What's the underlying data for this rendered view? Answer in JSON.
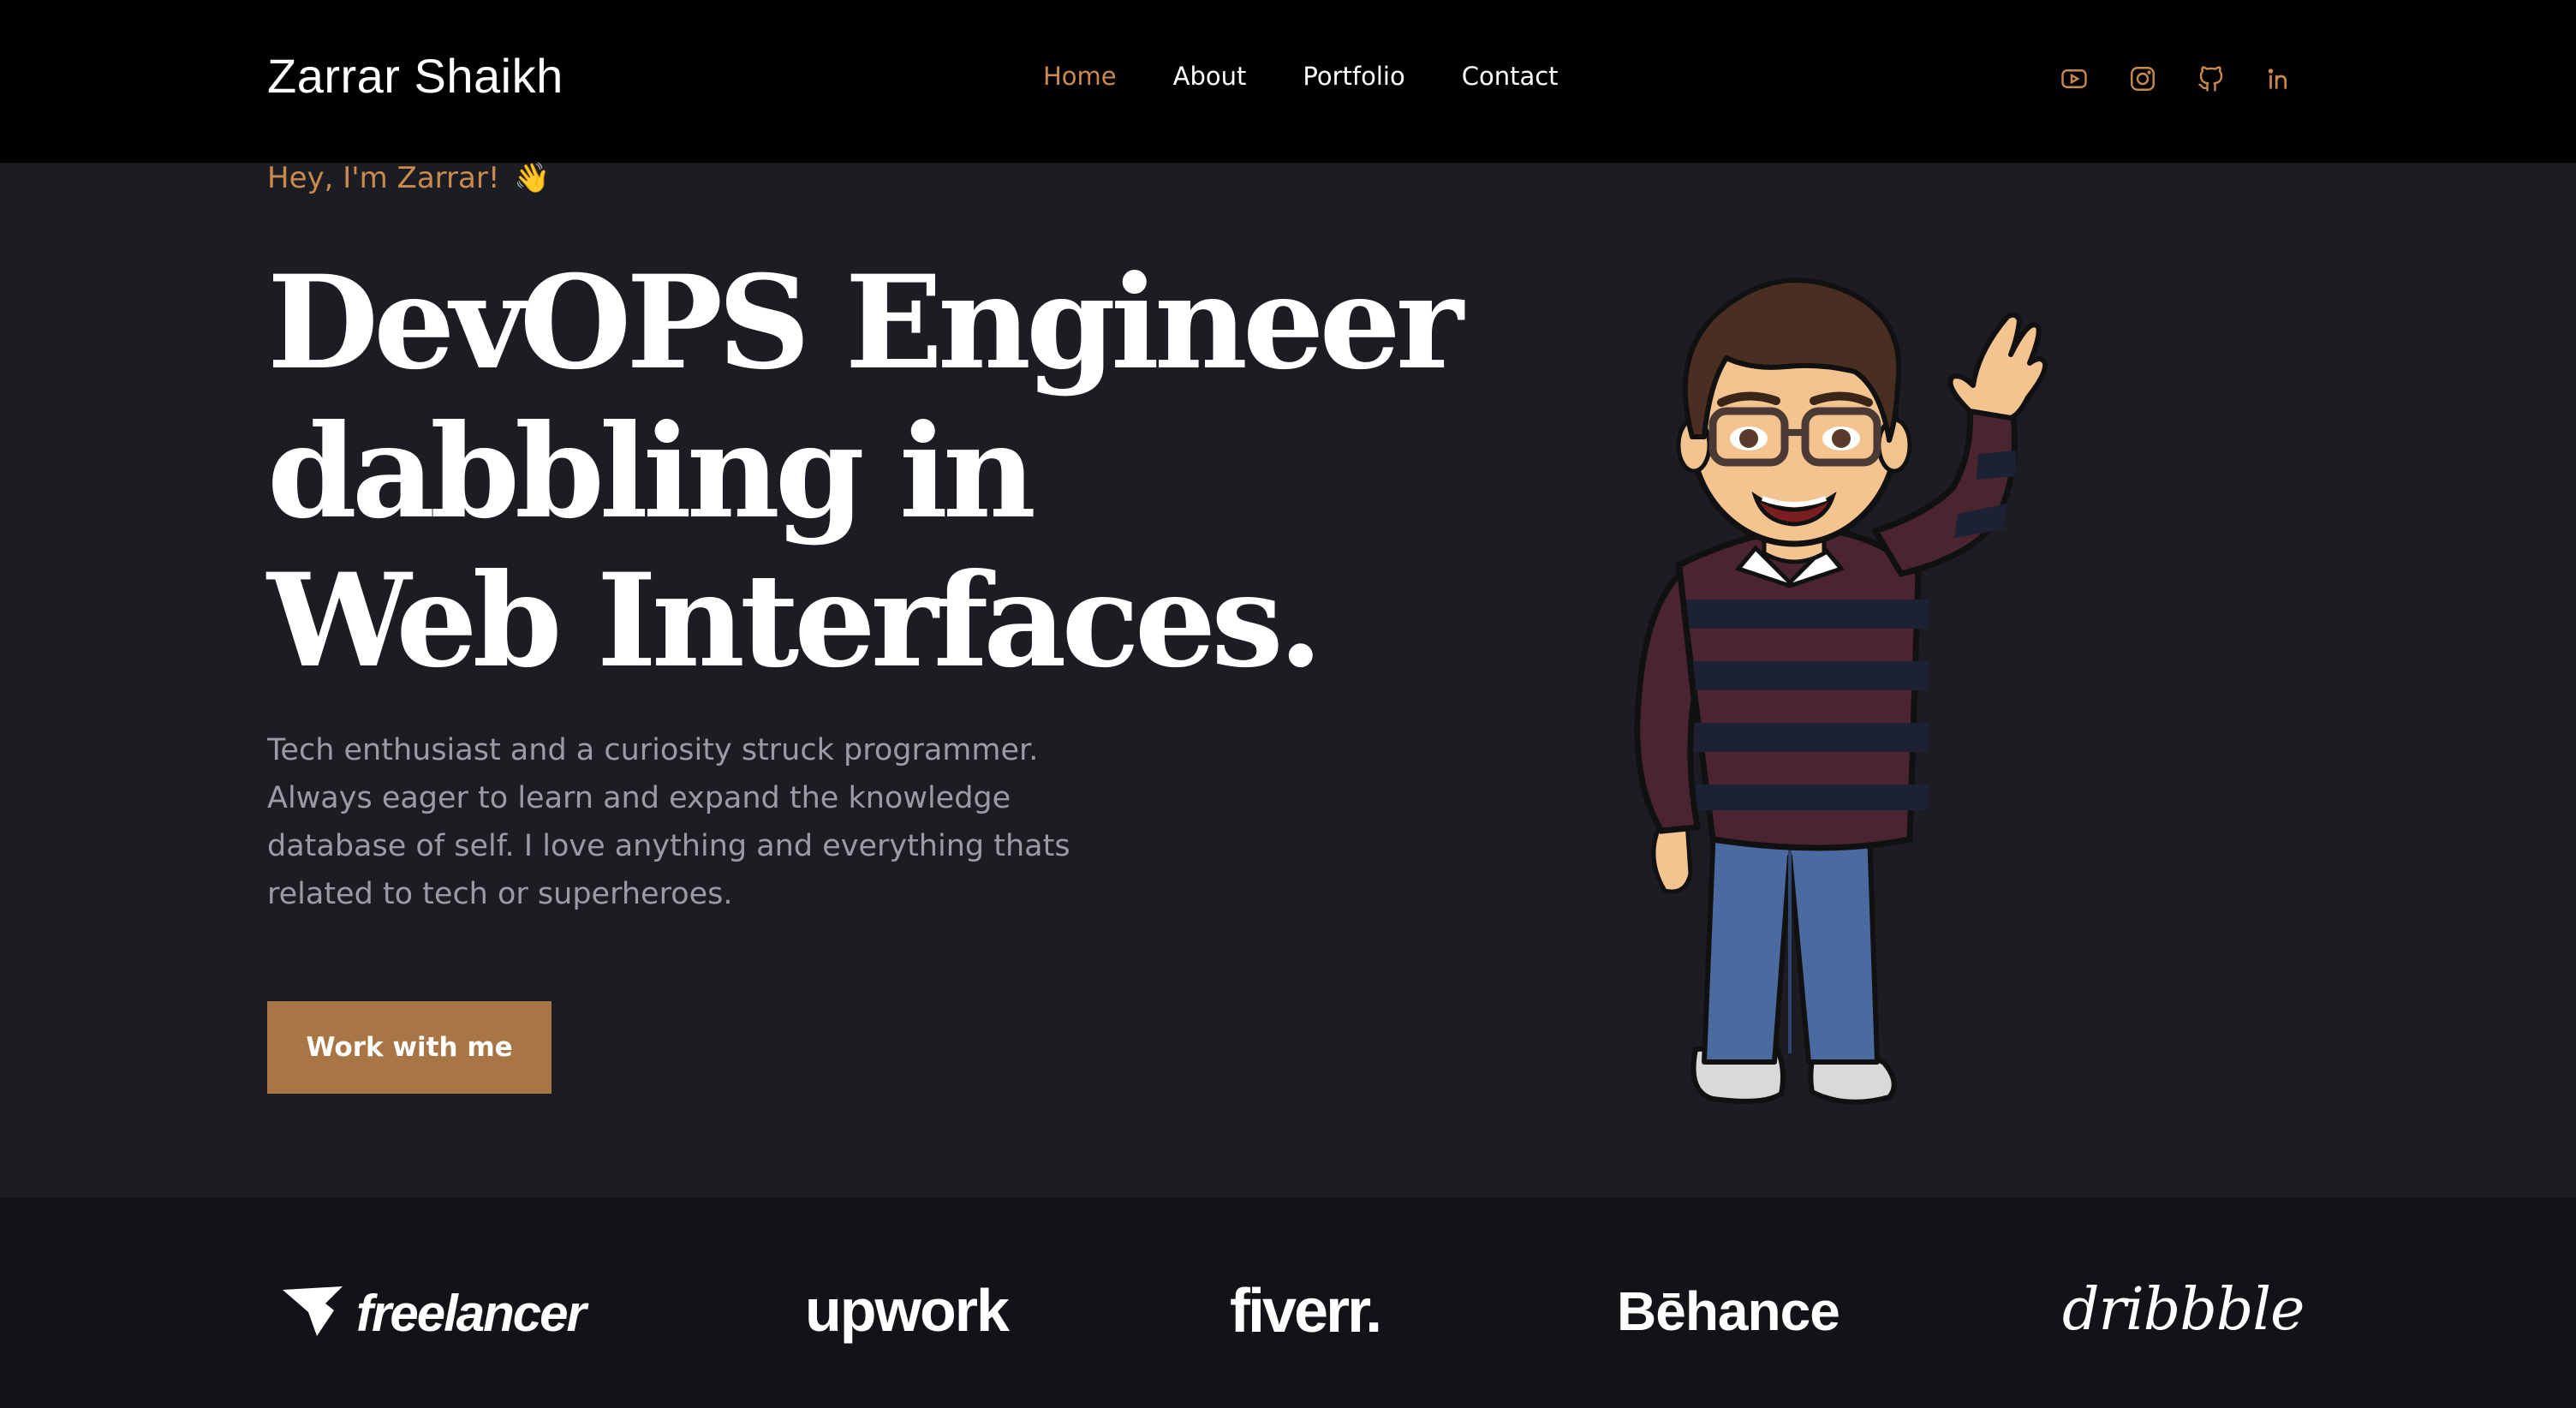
{
  "header": {
    "brand": "Zarrar Shaikh",
    "nav": [
      {
        "label": "Home",
        "active": true
      },
      {
        "label": "About",
        "active": false
      },
      {
        "label": "Portfolio",
        "active": false
      },
      {
        "label": "Contact",
        "active": false
      }
    ],
    "socials": [
      "youtube-icon",
      "instagram-icon",
      "github-icon",
      "linkedin-icon"
    ]
  },
  "hero": {
    "greeting": "Hey, I'm Zarrar!",
    "greeting_emoji": "👋",
    "headline": [
      "DevOPS Engineer",
      "dabbling in",
      "Web Interfaces."
    ],
    "bio": "Tech enthusiast and a curiosity struck programmer. Always eager to learn and expand the knowledge database of self. I love anything and everything thats related to tech or superheroes.",
    "cta": "Work with me"
  },
  "logos": {
    "freelancer": "freelancer",
    "upwork": "upwork",
    "fiverr": "fiverr.",
    "behance": "Bēhance",
    "dribbble": "dribbble"
  },
  "colors": {
    "accent": "#c98a4e",
    "button": "#a87644",
    "background": "#1c1d22",
    "header": "#000000",
    "logo_strip": "#121317",
    "muted_text": "#9a9ba6"
  }
}
